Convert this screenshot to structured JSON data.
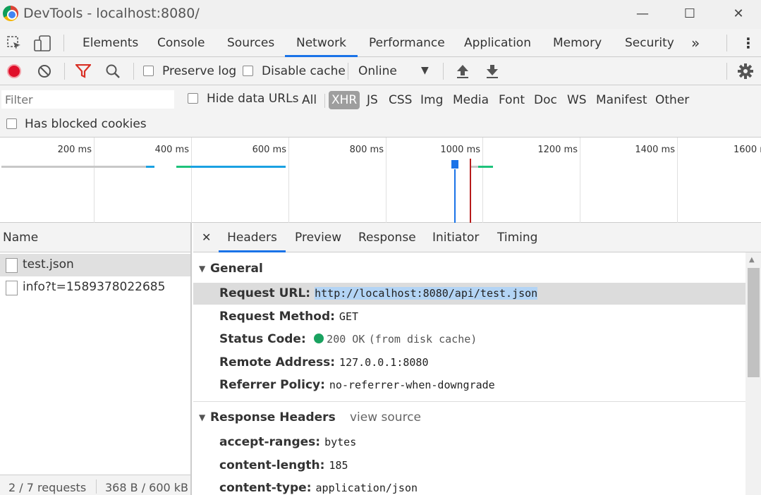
{
  "window": {
    "title": "DevTools - localhost:8080/",
    "minimize": "—",
    "maximize": "☐",
    "close": "✕"
  },
  "tabs": [
    {
      "label": "Elements"
    },
    {
      "label": "Console"
    },
    {
      "label": "Sources"
    },
    {
      "label": "Network",
      "active": true
    },
    {
      "label": "Performance"
    },
    {
      "label": "Application"
    },
    {
      "label": "Memory"
    },
    {
      "label": "Security"
    }
  ],
  "tabs_more": "»",
  "tabs_menu": "⋮",
  "toolbar": {
    "preserve_log": "Preserve log",
    "disable_cache": "Disable cache",
    "throttle": "Online",
    "throttle_arrow": "▼"
  },
  "filter": {
    "placeholder": "Filter",
    "hide_data_urls": "Hide data URLs",
    "types": [
      "All",
      "XHR",
      "JS",
      "CSS",
      "Img",
      "Media",
      "Font",
      "Doc",
      "WS",
      "Manifest",
      "Other"
    ],
    "selected_type": "XHR",
    "blocked_cookies": "Has blocked cookies"
  },
  "timeline": {
    "ticks": [
      "200 ms",
      "400 ms",
      "600 ms",
      "800 ms",
      "1000 ms",
      "1200 ms",
      "1400 ms",
      "1600 ms"
    ]
  },
  "request_list": {
    "header": "Name",
    "rows": [
      {
        "name": "test.json",
        "selected": true
      },
      {
        "name": "info?t=1589378022685",
        "selected": false
      }
    ],
    "footer_requests": "2 / 7 requests",
    "footer_size": "368 B / 600 kB"
  },
  "details": {
    "close": "✕",
    "tabs": [
      "Headers",
      "Preview",
      "Response",
      "Initiator",
      "Timing"
    ],
    "active_tab": "Headers",
    "general": {
      "title": "General",
      "request_url_key": "Request URL:",
      "request_url": "http://localhost:8080/api/test.json",
      "method_key": "Request Method:",
      "method": "GET",
      "status_key": "Status Code:",
      "status": "200 OK",
      "status_extra": "(from disk cache)",
      "status_color": "#1aa260",
      "remote_key": "Remote Address:",
      "remote": "127.0.0.1:8080",
      "referrer_key": "Referrer Policy:",
      "referrer": "no-referrer-when-downgrade"
    },
    "response_headers": {
      "title": "Response Headers",
      "view_source": "view source",
      "items": [
        {
          "key": "accept-ranges:",
          "value": "bytes"
        },
        {
          "key": "content-length:",
          "value": "185"
        },
        {
          "key": "content-type:",
          "value": "application/json"
        }
      ]
    }
  },
  "colors": {
    "accent": "#1a73e8",
    "record": "#e0102b",
    "filter_active": "#d93025",
    "bar_blue": "#1aa1e2",
    "bar_green": "#1ec27b",
    "line_red": "#b71c1c"
  },
  "icons": [
    "chrome-logo-icon",
    "inspect-icon",
    "device-icon",
    "record-icon",
    "clear-icon",
    "filter-icon",
    "search-icon",
    "upload-icon",
    "download-icon",
    "gear-icon",
    "file-icon",
    "triangle-down-icon"
  ]
}
